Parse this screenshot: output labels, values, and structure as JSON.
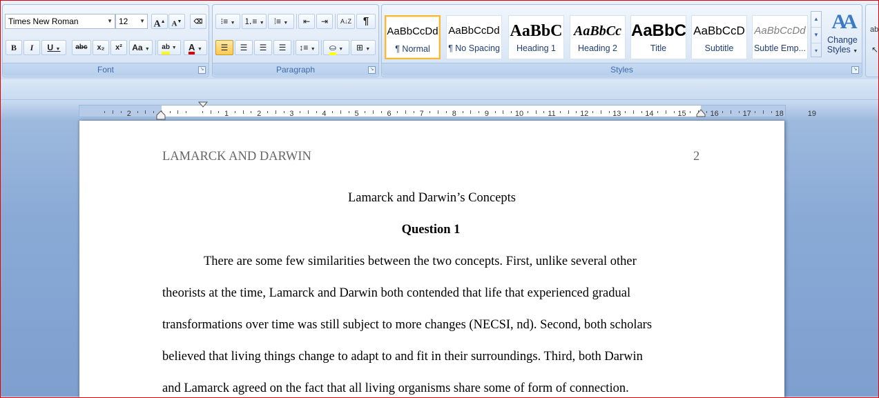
{
  "font_group": {
    "label": "Font",
    "font_name": "Times New Roman",
    "font_size": "12",
    "grow_font": "A",
    "shrink_font": "A",
    "bold": "B",
    "italic": "I",
    "underline": "U",
    "strikethrough": "abc",
    "subscript": "x₂",
    "superscript": "x²",
    "change_case": "Aa",
    "highlight": "ab",
    "font_color": "A"
  },
  "paragraph_group": {
    "label": "Paragraph",
    "show_marks": "¶",
    "sort": "A↓Z"
  },
  "styles_group": {
    "label": "Styles",
    "styles": [
      {
        "sample": "AaBbCcDd",
        "name": "¶ Normal"
      },
      {
        "sample": "AaBbCcDd",
        "name": "¶ No Spacing"
      },
      {
        "sample": "AaBbC",
        "name": "Heading 1"
      },
      {
        "sample": "AaBbCc",
        "name": "Heading 2"
      },
      {
        "sample": "AaBbC",
        "name": "Title"
      },
      {
        "sample": "AaBbCcD",
        "name": "Subtitle"
      },
      {
        "sample": "AaBbCcDd",
        "name": "Subtle Emp..."
      }
    ],
    "change_styles_line1": "Change",
    "change_styles_line2": "Styles"
  },
  "ruler": {
    "left_numbers": [
      "2",
      "1"
    ],
    "numbers": [
      "1",
      "2",
      "3",
      "4",
      "5",
      "6",
      "7",
      "8",
      "9",
      "10",
      "11",
      "12",
      "13",
      "14",
      "15",
      "16",
      "17",
      "18",
      "19"
    ]
  },
  "document": {
    "running_head": "LAMARCK AND DARWIN",
    "page_number": "2",
    "title": "Lamarck and Darwin’s Concepts",
    "heading": "Question 1",
    "lines": [
      "There are some few similarities between the two concepts. First, unlike several other",
      "theorists at the time, Lamarck and Darwin both contended that life that experienced gradual",
      "transformations over time was still subject to more changes (NECSI,  nd). Second, both scholars",
      "believed that living things change to adapt to and fit in their surroundings. Third, both Darwin",
      "and Lamarck agreed on the fact that all living organisms share some of form of connection."
    ]
  },
  "colors": {
    "ribbon_text": "#15428b",
    "highlight_bar": "#ffff00",
    "font_color_bar": "#e00000",
    "selected_style_border": "#f6b73c"
  }
}
